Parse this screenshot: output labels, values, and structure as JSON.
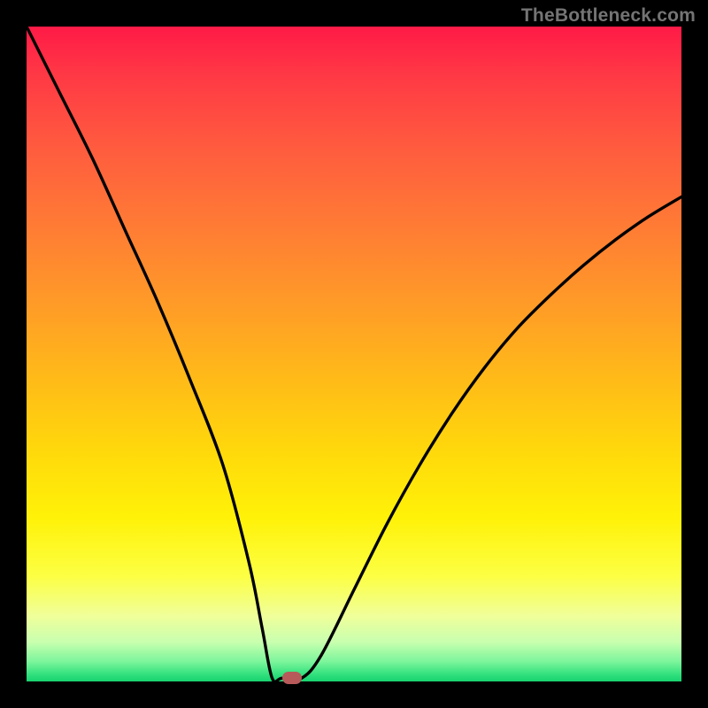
{
  "watermark": "TheBottleneck.com",
  "chart_data": {
    "type": "line",
    "title": "",
    "xlabel": "",
    "ylabel": "",
    "xlim": [
      0,
      100
    ],
    "ylim": [
      0,
      100
    ],
    "grid": false,
    "legend": false,
    "series": [
      {
        "name": "curve",
        "x": [
          0,
          5,
          10,
          15,
          20,
          25,
          30,
          34,
          36,
          37.5,
          39,
          42,
          45,
          50,
          55,
          60,
          65,
          70,
          75,
          80,
          85,
          90,
          95,
          100
        ],
        "y": [
          100,
          90,
          80,
          69,
          58,
          46,
          33,
          18,
          8,
          0.5,
          0.5,
          0.5,
          4,
          14,
          24,
          33,
          41,
          48,
          54,
          59,
          63.5,
          67.5,
          71,
          74
        ]
      }
    ],
    "marker": {
      "x": 40.5,
      "y": 0.5
    },
    "colors": {
      "curve": "#000000",
      "marker": "#b85a5a",
      "top": "#ff1a47",
      "bottom": "#17d26f"
    }
  }
}
